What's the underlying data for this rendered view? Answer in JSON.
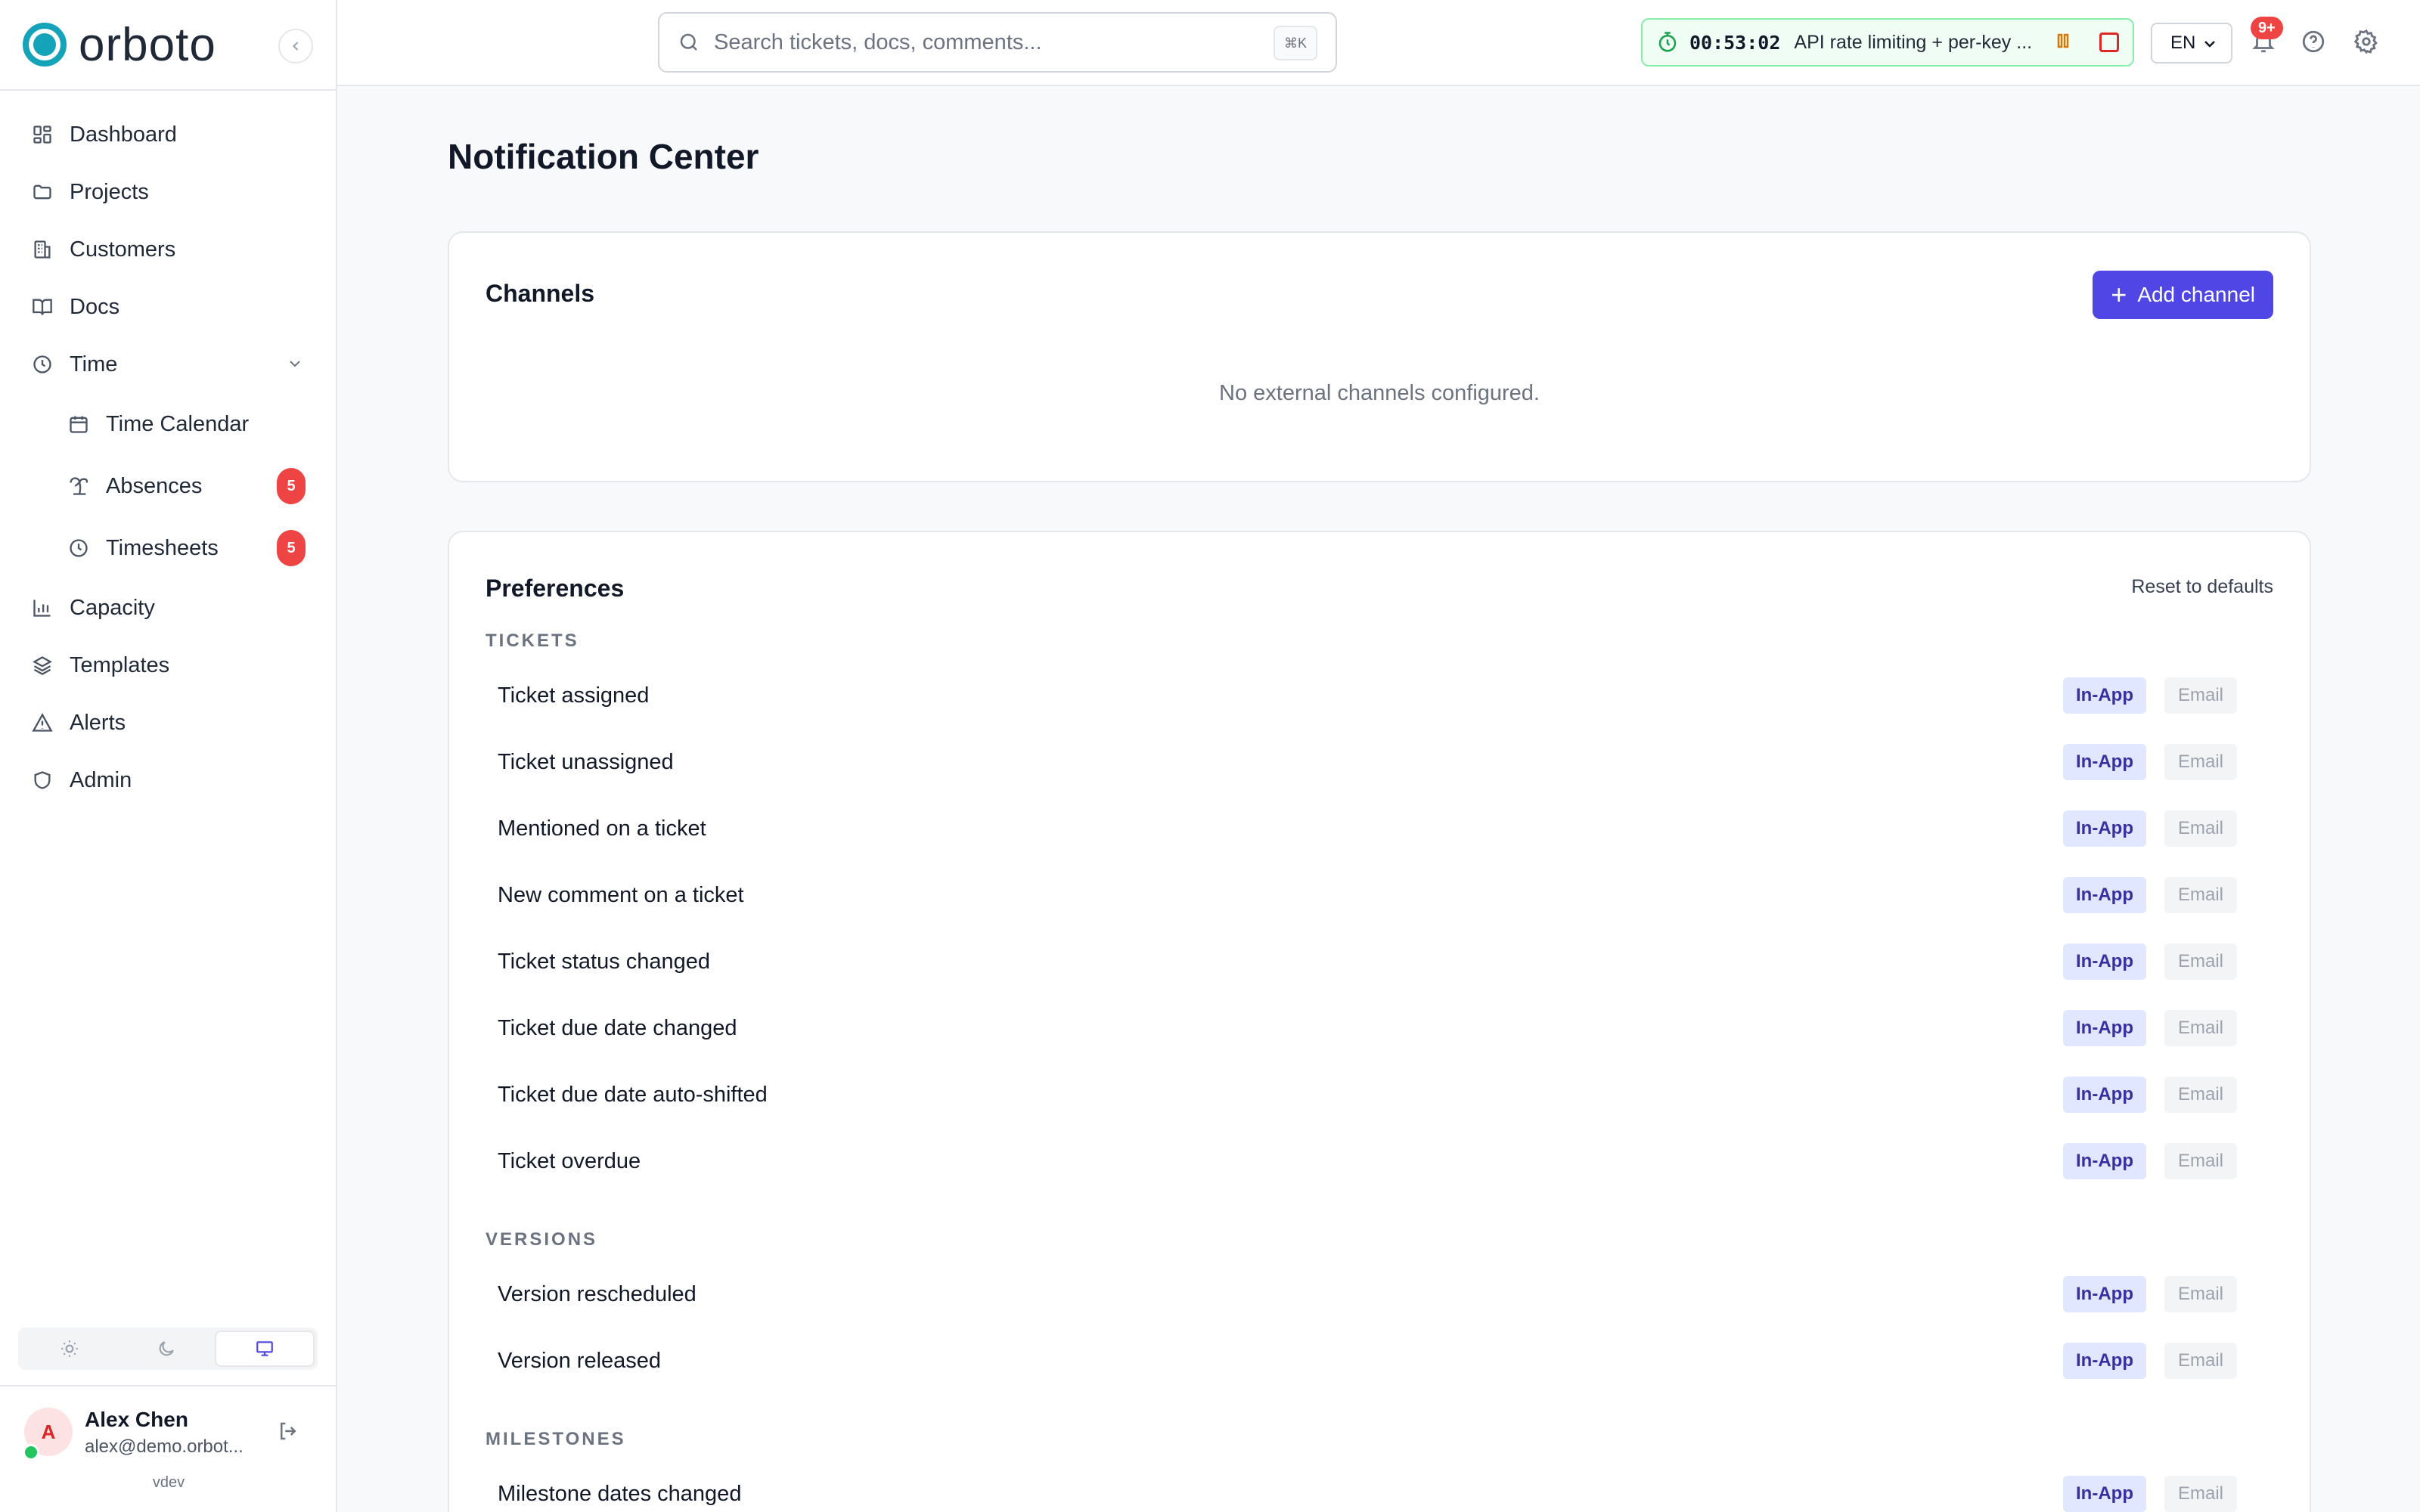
{
  "brand": {
    "name": "orboto"
  },
  "sidebar": {
    "items": [
      {
        "label": "Dashboard",
        "icon": "dashboard-icon"
      },
      {
        "label": "Projects",
        "icon": "folder-icon"
      },
      {
        "label": "Customers",
        "icon": "building-icon"
      },
      {
        "label": "Docs",
        "icon": "book-icon"
      },
      {
        "label": "Time",
        "icon": "clock-icon",
        "expanded": true
      },
      {
        "label": "Time Calendar",
        "icon": "calendar-icon"
      },
      {
        "label": "Absences",
        "icon": "palm-tree-icon",
        "badge": "5"
      },
      {
        "label": "Timesheets",
        "icon": "clock-icon",
        "badge": "5"
      },
      {
        "label": "Capacity",
        "icon": "bar-chart-icon"
      },
      {
        "label": "Templates",
        "icon": "layers-icon"
      },
      {
        "label": "Alerts",
        "icon": "warning-icon"
      },
      {
        "label": "Admin",
        "icon": "shield-icon"
      }
    ],
    "theme": {
      "selected": "system"
    }
  },
  "user": {
    "initial": "A",
    "name": "Alex Chen",
    "email": "alex@demo.orbot...",
    "version": "vdev"
  },
  "topbar": {
    "search_placeholder": "Search tickets, docs, comments...",
    "shortcut": "⌘K",
    "timer": {
      "elapsed": "00:53:02",
      "task": "API rate limiting + per-key ..."
    },
    "language": "EN",
    "notifications_badge": "9+"
  },
  "page": {
    "title": "Notification Center"
  },
  "channels": {
    "title": "Channels",
    "add_label": "Add channel",
    "empty_message": "No external channels configured."
  },
  "preferences": {
    "title": "Preferences",
    "reset_label": "Reset to defaults",
    "inapp_label": "In-App",
    "email_label": "Email",
    "sections": [
      {
        "heading": "TICKETS",
        "rows": [
          "Ticket assigned",
          "Ticket unassigned",
          "Mentioned on a ticket",
          "New comment on a ticket",
          "Ticket status changed",
          "Ticket due date changed",
          "Ticket due date auto-shifted",
          "Ticket overdue"
        ]
      },
      {
        "heading": "VERSIONS",
        "rows": [
          "Version rescheduled",
          "Version released"
        ]
      },
      {
        "heading": "MILESTONES",
        "rows": [
          "Milestone dates changed"
        ]
      }
    ],
    "states": {
      "in_app": "enabled",
      "email": "disabled"
    }
  },
  "colors": {
    "accent": "#4f46e5",
    "brand": "#14a3b8",
    "badge": "#ef4444",
    "timer_border": "#86efac"
  }
}
